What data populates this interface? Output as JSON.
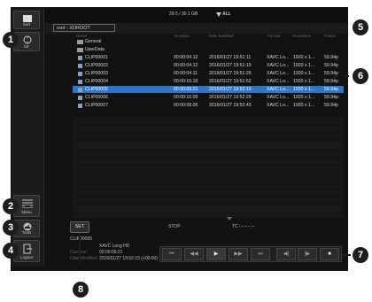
{
  "status_bar": {
    "storage": "29.5 / 30.1 GB",
    "filter": "ALL"
  },
  "path": {
    "root": "root",
    "folder": "XDROOT"
  },
  "columns": [
    "Name",
    "Duration",
    "Date Modified",
    "Format",
    "Resolution",
    "Frame"
  ],
  "folders": [
    {
      "name": "General"
    },
    {
      "name": "UserData"
    }
  ],
  "rows": [
    {
      "name": "CLIP00001",
      "duration": "00:00:04.12",
      "date": "2016/01/27 19:51:11",
      "format": "XAVC Lo...",
      "res": "1920 x 1...",
      "fps": "59.94p"
    },
    {
      "name": "CLIP00002",
      "duration": "00:00:04.12",
      "date": "2016/01/27 19:51:19",
      "format": "XAVC Lo...",
      "res": "1920 x 1...",
      "fps": "59.94p"
    },
    {
      "name": "CLIP00003",
      "duration": "00:00:04.11",
      "date": "2016/01/27 19:51:26",
      "format": "XAVC Lo...",
      "res": "1920 x 1...",
      "fps": "59.94p"
    },
    {
      "name": "CLIP00004",
      "duration": "00:00:10.18",
      "date": "2016/01/27 19:51:52",
      "format": "XAVC Lo...",
      "res": "1920 x 1...",
      "fps": "59.94p"
    },
    {
      "name": "CLIP00005",
      "duration": "00:00:09.21",
      "date": "2016/01/27 19:52:15",
      "format": "XAVC Lo...",
      "res": "1920 x 1...",
      "fps": "59.94p"
    },
    {
      "name": "CLIP00006",
      "duration": "00:00:10.09",
      "date": "2016/01/27 19:52:28",
      "format": "XAVC Lo...",
      "res": "1920 x 1...",
      "fps": "59.94p"
    },
    {
      "name": "CLIP00007",
      "duration": "00:00:08.06",
      "date": "2016/01/27 19:52:43",
      "format": "XAVC Lo...",
      "res": "1920 x 1...",
      "fps": "59.94p"
    }
  ],
  "selected_index": 4,
  "left_buttons": {
    "sort": "Sort",
    "dir": "Dir",
    "menu": "Menu",
    "tools": "Tools",
    "logout": "Logout"
  },
  "set_button": "SET",
  "playback": {
    "state": "STOP",
    "timecode": "TC --:--:--:--"
  },
  "selected_info": {
    "clip": "CLIP00005",
    "format": "XAVC Long HD",
    "duration_label": "Duration",
    "duration": "00:00:09.21",
    "modified_label": "Date Modified",
    "modified": "2016/01/27 19:52:15 (+00:00)"
  },
  "callouts": [
    "1",
    "2",
    "3",
    "4",
    "5",
    "6",
    "7",
    "8"
  ]
}
